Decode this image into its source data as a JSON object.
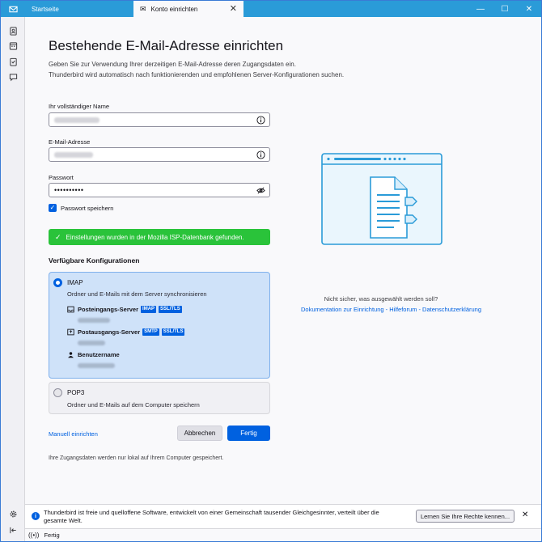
{
  "tabs": [
    {
      "label": "Startseite"
    },
    {
      "label": "Konto einrichten"
    }
  ],
  "window_controls": {
    "minimize": "—",
    "maximize": "☐",
    "close": "✕"
  },
  "page": {
    "title": "Bestehende E-Mail-Adresse einrichten",
    "intro_line1": "Geben Sie zur Verwendung Ihrer derzeitigen E-Mail-Adresse deren Zugangsdaten ein.",
    "intro_line2": "Thunderbird wird automatisch nach funktionierenden und empfohlenen Server-Konfigurationen suchen."
  },
  "form": {
    "name_label": "Ihr vollständiger Name",
    "email_label": "E-Mail-Adresse",
    "password_label": "Passwort",
    "password_value": "••••••••••",
    "remember_label": "Passwort speichern",
    "remember_checked": true
  },
  "status": {
    "success_text": "Einstellungen wurden in der Mozilla ISP-Datenbank gefunden."
  },
  "configs": {
    "section_title": "Verfügbare Konfigurationen",
    "imap": {
      "title": "IMAP",
      "subtitle": "Ordner und E-Mails mit dem Server synchronisieren",
      "incoming_label": "Posteingangs-Server",
      "incoming_badges": [
        "IMAP",
        "SSL/TLS"
      ],
      "outgoing_label": "Postausgangs-Server",
      "outgoing_badges": [
        "SMTP",
        "SSL/TLS"
      ],
      "username_label": "Benutzername"
    },
    "pop3": {
      "title": "POP3",
      "subtitle": "Ordner und E-Mails auf dem Computer speichern"
    }
  },
  "actions": {
    "manual": "Manuell einrichten",
    "cancel": "Abbrechen",
    "done": "Fertig",
    "footnote": "Ihre Zugangsdaten werden nur lokal auf Ihrem Computer gespeichert."
  },
  "help": {
    "question": "Nicht sicher, was ausgewählt werden soll?",
    "links": "Dokumentation zur Einrichtung - Hilfeforum - Datenschutzerklärung"
  },
  "notification": {
    "text": "Thunderbird ist freie und quelloffene Software, entwickelt von einer Gemeinschaft tausender Gleichgesinnter, verteilt über die gesamte Welt.",
    "button": "Lernen Sie Ihre Rechte kennen...",
    "close": "✕"
  },
  "statusbar": {
    "text": "Fertig"
  },
  "colors": {
    "accent": "#0061e0",
    "titlebar": "#2a9bd8",
    "success": "#2ac33a",
    "selected_config": "#cfe2f9"
  },
  "icons": [
    "mail-icon",
    "address-book-icon",
    "calendar-icon",
    "tasks-icon",
    "chat-icon",
    "settings-icon",
    "collapse-icon",
    "info-icon",
    "eye-slash-icon",
    "document-illustration"
  ]
}
